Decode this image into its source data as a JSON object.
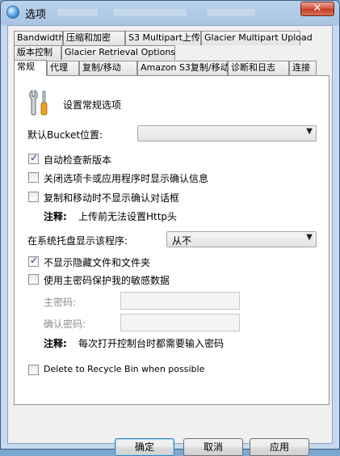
{
  "window": {
    "title": "选项",
    "close_glyph": "✕"
  },
  "tabs_row1": [
    "Bandwidth",
    "压缩和加密",
    "S3 Multipart上传",
    "Glacier Multipart Upload"
  ],
  "tabs_row2": [
    "版本控制",
    "Glacier Retrieval Options"
  ],
  "tabs_row3": [
    "常规",
    "代理",
    "复制/移动",
    "Amazon S3复制/移动",
    "诊断和日志",
    "连接"
  ],
  "active_tab": "常规",
  "general": {
    "section_icon": "tools-icon",
    "section_title": "设置常规选项",
    "bucket_label": "默认Bucket位置:",
    "bucket_value": "",
    "check_updates": {
      "label": "自动检查新版本",
      "checked": true
    },
    "confirm_close": {
      "label": "关闭选项卡或应用程序时显示确认信息",
      "checked": false
    },
    "no_confirm_copy": {
      "label": "复制和移动时不显示确认对话框",
      "checked": false
    },
    "note1_label": "注释:",
    "note1_text": "上传前无法设置Http头",
    "tray_label": "在系统托盘显示该程序:",
    "tray_value": "从不",
    "hide_hidden": {
      "label": "不显示隐藏文件和文件夹",
      "checked": true
    },
    "master_pw": {
      "label": "使用主密码保护我的敏感数据",
      "checked": false
    },
    "master_pw_label": "主密码:",
    "confirm_pw_label": "确认密码:",
    "note2_label": "注释:",
    "note2_text": "每次打开控制台时都需要输入密码",
    "recycle_bin": {
      "label": "Delete to Recycle Bin when possible",
      "checked": false
    }
  },
  "buttons": {
    "ok": "确定",
    "cancel": "取消",
    "apply": "应用"
  }
}
